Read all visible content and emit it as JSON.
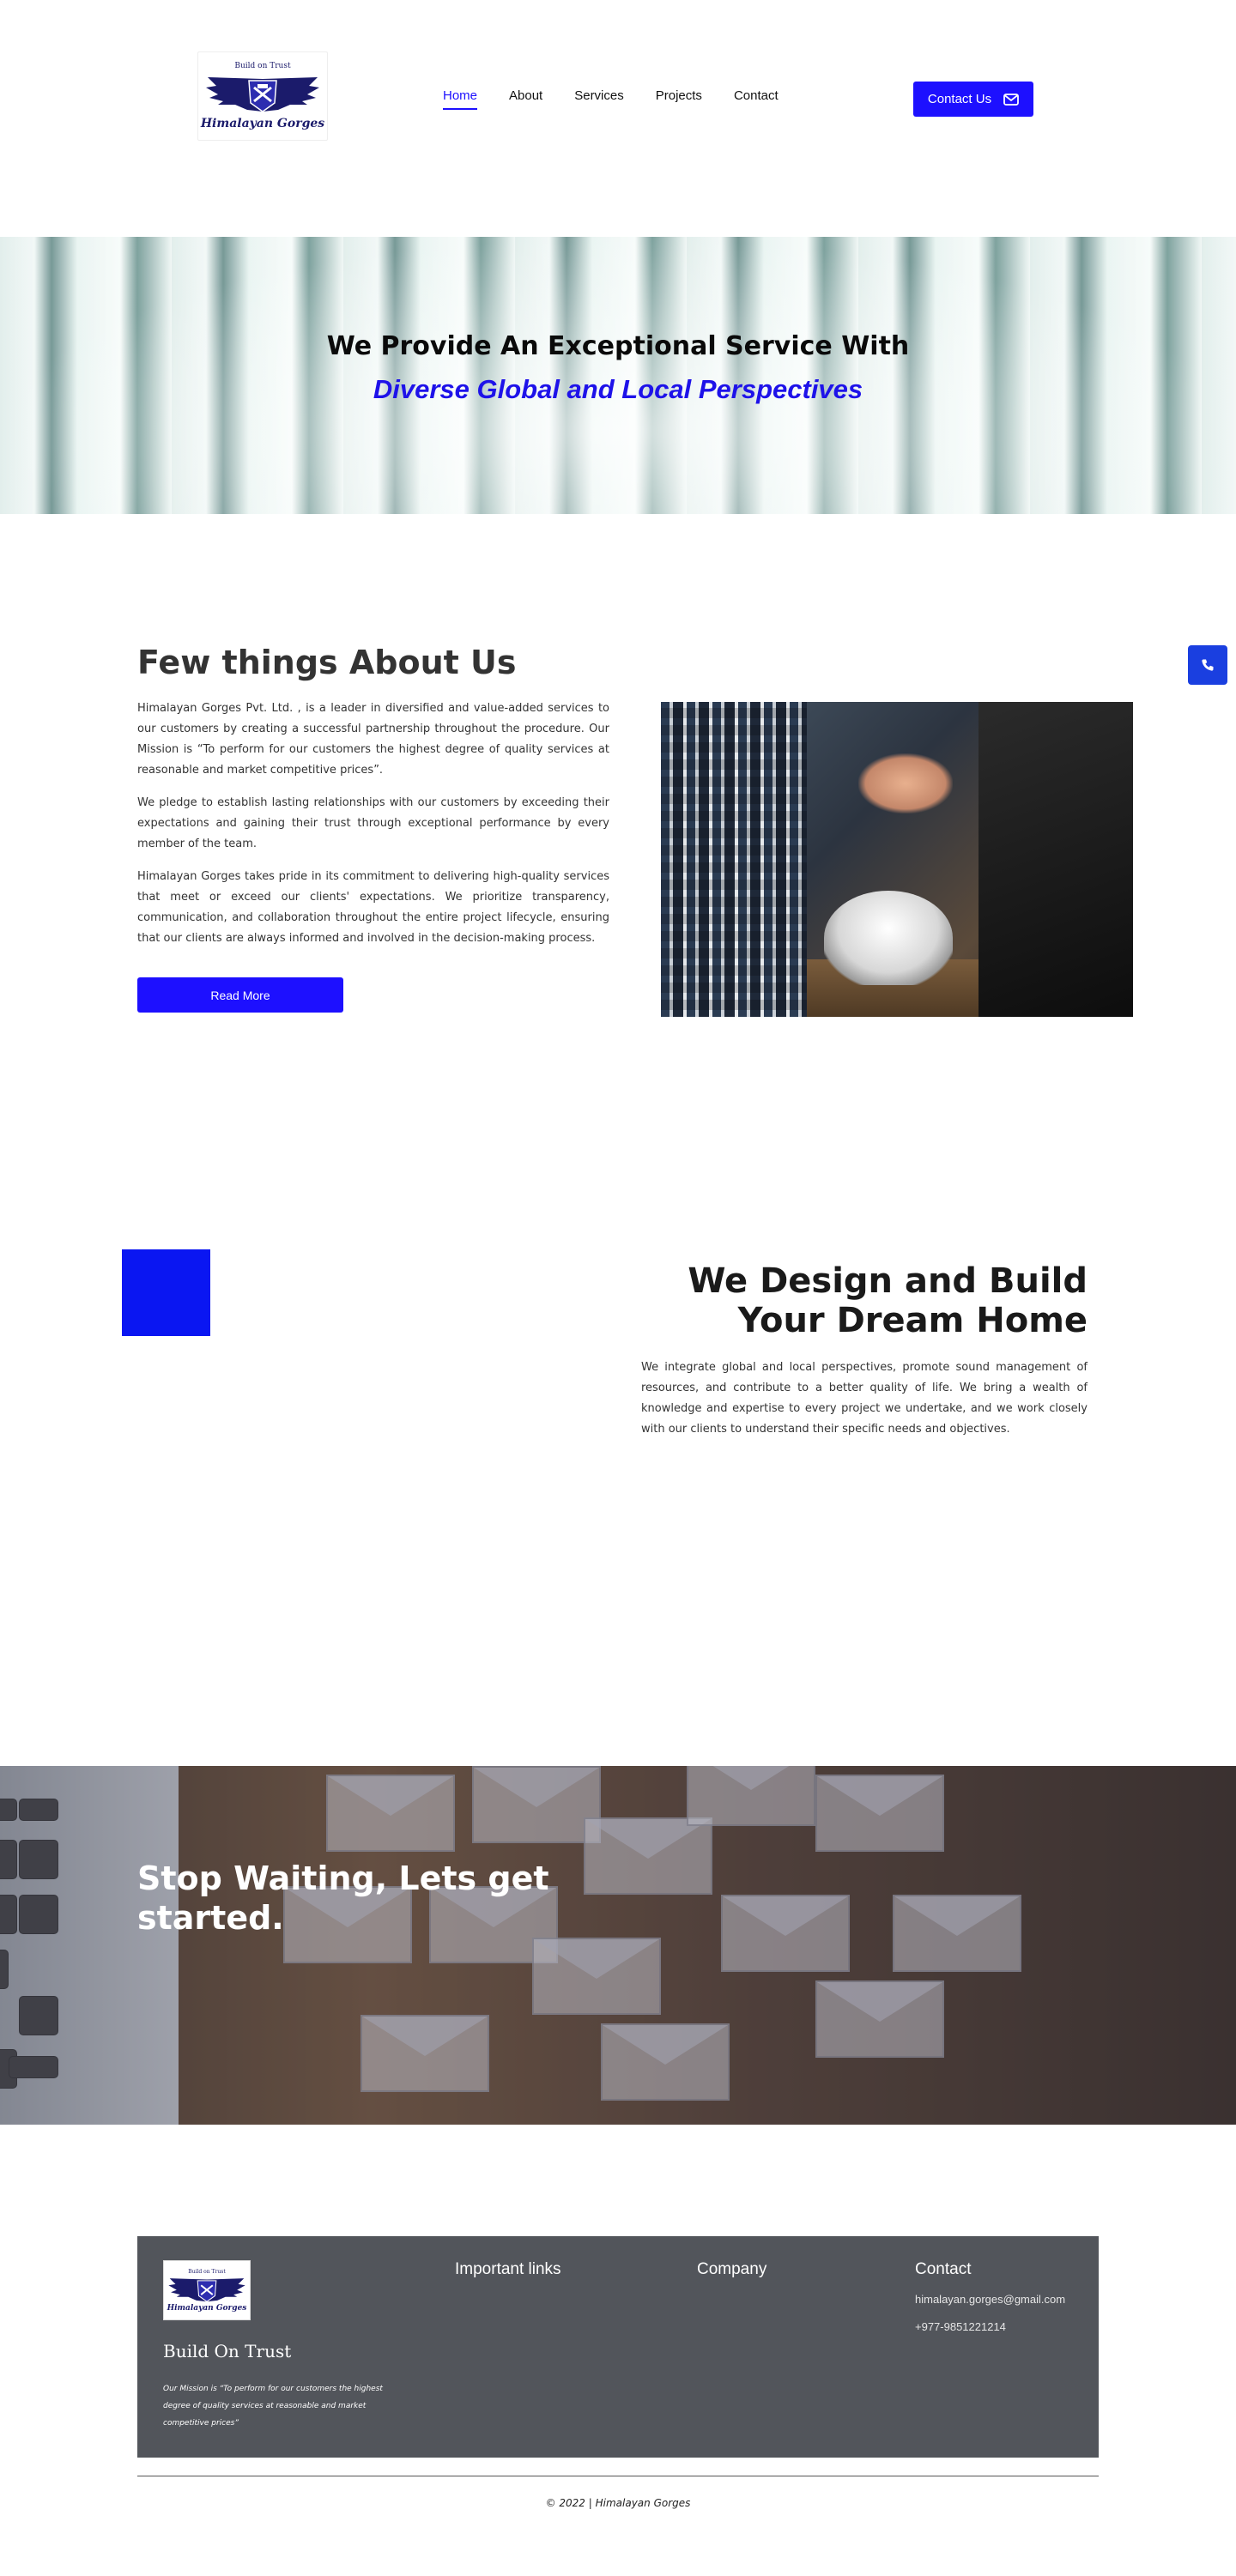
{
  "header": {
    "logo_tagline": "Build on Trust",
    "logo_brand": "Himalayan Gorges",
    "nav": [
      {
        "label": "Home",
        "active": true
      },
      {
        "label": "About",
        "active": false
      },
      {
        "label": "Services",
        "active": false
      },
      {
        "label": "Projects",
        "active": false
      },
      {
        "label": "Contact",
        "active": false
      }
    ],
    "contact_button": "Contact Us",
    "contact_icon": "envelope-icon"
  },
  "hero": {
    "line1": "We Provide An Exceptional Service With",
    "line2": "Diverse Global and Local Perspectives"
  },
  "floating_phone_icon": "phone-icon",
  "about": {
    "title": "Few things About Us",
    "paragraphs": [
      "Himalayan Gorges Pvt. Ltd. , is a leader in diversified and value-added services to our customers by creating a successful partnership throughout the procedure. Our Mission is “To perform for our customers the highest degree of quality services at reasonable and market competitive prices”.",
      "We pledge to establish lasting relationships with our customers by exceeding their expectations and gaining their trust through exceptional performance by every member of the team.",
      "Himalayan Gorges takes pride in its commitment to delivering high-quality services that meet or exceed our clients' expectations. We prioritize transparency, communication, and collaboration throughout the entire project lifecycle, ensuring that our clients are always informed and involved in the decision-making process."
    ],
    "read_more": "Read More"
  },
  "design": {
    "title_line1": "We Design and Build",
    "title_line2": "Your Dream Home",
    "text": "We integrate global and local perspectives, promote sound management of resources, and contribute to a better quality of life. We bring a wealth of knowledge and expertise to every project we undertake, and we work closely with our clients to understand their specific needs and objectives."
  },
  "cta": {
    "title": "Stop Waiting, Lets get started."
  },
  "footer": {
    "logo_tagline": "Build on Trust",
    "logo_brand": "Himalayan Gorges",
    "build_on_trust": "Build On Trust",
    "mission": "Our Mission is “To perform for our customers the highest degree of quality services at reasonable and market competitive prices”",
    "important_links": "Important links",
    "company": "Company",
    "contact": "Contact",
    "email": "himalayan.gorges@gmail.com",
    "phone": "+977-9851221214",
    "copyright": "© 2022 | Himalayan Gorges"
  },
  "colors": {
    "accent": "#1d10ff",
    "footer_bg": "#52555b",
    "square": "#0a16f2"
  }
}
